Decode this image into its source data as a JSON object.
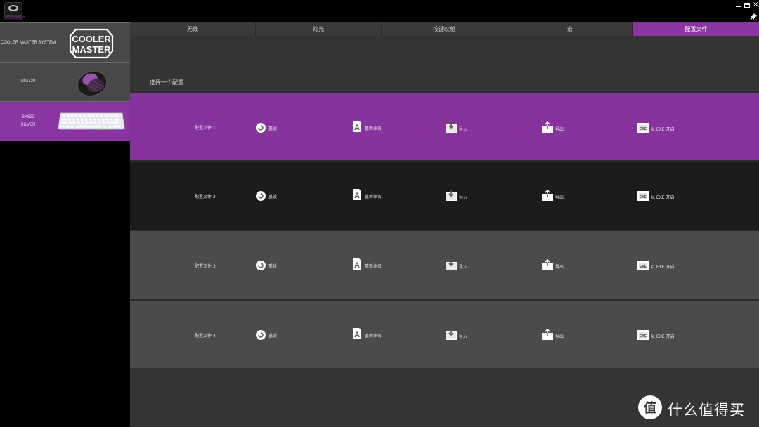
{
  "app": {
    "logo_text": "MASTERPLUS+"
  },
  "window_controls": {
    "close_glyph": "×"
  },
  "devices": [
    {
      "name": "COOLER MASTER SYSTEM",
      "logo_text": [
        "COOLER",
        "MASTER"
      ]
    },
    {
      "name": "MM720"
    },
    {
      "name_line1": "SK622",
      "name_line2": "SILVER"
    }
  ],
  "tabs": [
    {
      "label": "无线"
    },
    {
      "label": "灯光"
    },
    {
      "label": "按键映射"
    },
    {
      "label": "宏"
    },
    {
      "label": "配置文件",
      "active": true
    }
  ],
  "main": {
    "section_label": "选择一个配置"
  },
  "profiles": [
    {
      "name": "配置文件 1"
    },
    {
      "name": "配置文件 2"
    },
    {
      "name": "配置文件 3"
    },
    {
      "name": "配置文件 4"
    }
  ],
  "actions": {
    "reset": "重设",
    "rename": "重新命名",
    "import": "导入",
    "export": "导出",
    "exe": "以 EXE 开启",
    "exe_icon_text": "EXE"
  },
  "watermark": {
    "text": "什么值得买",
    "icon_glyph": "值"
  },
  "colors": {
    "accent": "#8a35a2",
    "profile_selected": "#86339e"
  }
}
